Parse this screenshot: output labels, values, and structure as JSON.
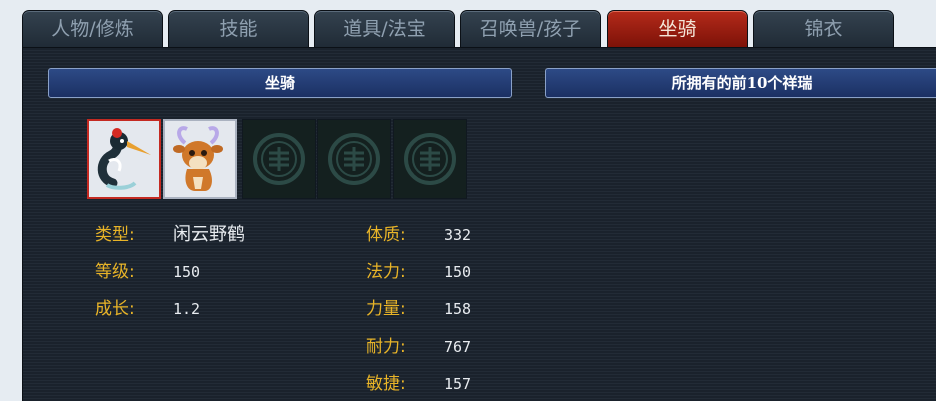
{
  "tabs": [
    {
      "label": "人物/修炼"
    },
    {
      "label": "技能"
    },
    {
      "label": "道具/法宝"
    },
    {
      "label": "召唤兽/孩子"
    },
    {
      "label": "坐骑"
    },
    {
      "label": "锦衣"
    }
  ],
  "active_tab": "坐骑",
  "panel": {
    "mount_header": "坐骑",
    "rares_header": "所拥有的前10个祥瑞"
  },
  "mount_slots": [
    {
      "icon": "crane-mount-icon",
      "filled": true,
      "selected": true
    },
    {
      "icon": "deer-mount-icon",
      "filled": true,
      "selected": false
    },
    {
      "icon": "empty-slot-emblem-icon",
      "filled": false,
      "selected": false
    },
    {
      "icon": "empty-slot-emblem-icon",
      "filled": false,
      "selected": false
    },
    {
      "icon": "empty-slot-emblem-icon",
      "filled": false,
      "selected": false
    }
  ],
  "mount_info": {
    "type_label": "类型:",
    "type_value": "闲云野鹤",
    "level_label": "等级:",
    "level_value": "150",
    "growth_label": "成长:",
    "growth_value": "1.2"
  },
  "mount_stats": {
    "constitution_label": "体质:",
    "constitution_value": "332",
    "magic_label": "法力:",
    "magic_value": "150",
    "strength_label": "力量:",
    "strength_value": "158",
    "endurance_label": "耐力:",
    "endurance_value": "767",
    "agility_label": "敏捷:",
    "agility_value": "157"
  },
  "colors": {
    "active_tab": "#a51f12",
    "label_gold": "#e8b428",
    "header_blue": "#24407a"
  }
}
